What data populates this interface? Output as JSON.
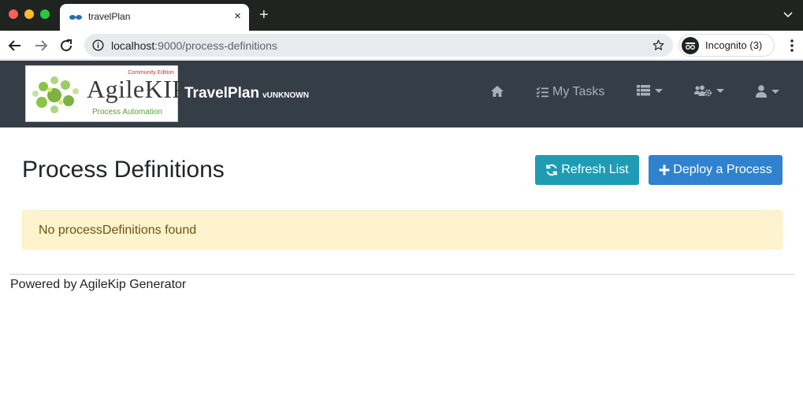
{
  "browser": {
    "tab_title": "travelPlan",
    "new_tab_symbol": "+",
    "close_symbol": "×",
    "url_host": "localhost",
    "url_rest": ":9000/process-definitions",
    "incognito_label": "Incognito (3)"
  },
  "navbar": {
    "logo": {
      "edition": "Community Edition",
      "name": "AgileKIP",
      "tagline": "Process Automation"
    },
    "brand": "TravelPlan",
    "version": "vUNKNOWN",
    "items": [
      {
        "icon": "home-icon",
        "label": ""
      },
      {
        "icon": "tasks-icon",
        "label": "My Tasks"
      },
      {
        "icon": "list-icon",
        "label": ""
      },
      {
        "icon": "users-cog-icon",
        "label": ""
      },
      {
        "icon": "user-icon",
        "label": ""
      }
    ]
  },
  "main": {
    "title": "Process Definitions",
    "refresh_label": "Refresh List",
    "deploy_label": "Deploy a Process",
    "empty_message": "No processDefinitions found"
  },
  "footer": {
    "text": "Powered by AgileKip Generator"
  },
  "colors": {
    "navbar_bg": "#353d47",
    "refresh_btn": "#1e9cb3",
    "deploy_btn": "#3182ce",
    "alert_bg": "#fff3cd"
  }
}
